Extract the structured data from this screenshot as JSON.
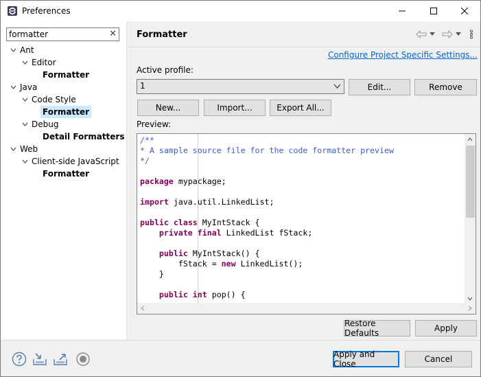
{
  "window": {
    "title": "Preferences"
  },
  "filter": {
    "value": "formatter"
  },
  "tree": {
    "ant": "Ant",
    "ant_editor": "Editor",
    "ant_editor_formatter": "Formatter",
    "java": "Java",
    "java_codestyle": "Code Style",
    "java_codestyle_formatter": "Formatter",
    "java_debug": "Debug",
    "java_debug_detail": "Detail Formatters",
    "web": "Web",
    "web_csjs": "Client-side JavaScript",
    "web_csjs_formatter": "Formatter"
  },
  "page": {
    "title": "Formatter",
    "configure_link": "Configure Project Specific Settings...",
    "active_profile_label": "Active profile:",
    "profile_value": "1",
    "edit_label": "Edit...",
    "remove_label": "Remove",
    "new_label": "New...",
    "import_label": "Import...",
    "export_label": "Export All...",
    "preview_label": "Preview:",
    "restore_label": "Restore Defaults",
    "apply_label": "Apply"
  },
  "code": {
    "l1": "/**",
    "l2": "* A sample source file for the code formatter preview",
    "l3": "*/",
    "l4_kw": "package",
    "l4_rest": " mypackage;",
    "l5_kw": "import",
    "l5_rest": " java.util.LinkedList;",
    "l6_kw1": "public",
    "l6_kw2": "class",
    "l6_rest": " MyIntStack {",
    "l7_kw1": "private",
    "l7_kw2": "final",
    "l7_rest": " LinkedList fStack;",
    "l8_kw": "public",
    "l8_rest": " MyIntStack() {",
    "l9_a": "fStack = ",
    "l9_kw": "new",
    "l9_b": " LinkedList();",
    "l10": "}",
    "l11_kw1": "public",
    "l11_kw2": "int",
    "l11_rest": " pop() {"
  },
  "footer": {
    "apply_close_label": "Apply and Close",
    "cancel_label": "Cancel"
  }
}
